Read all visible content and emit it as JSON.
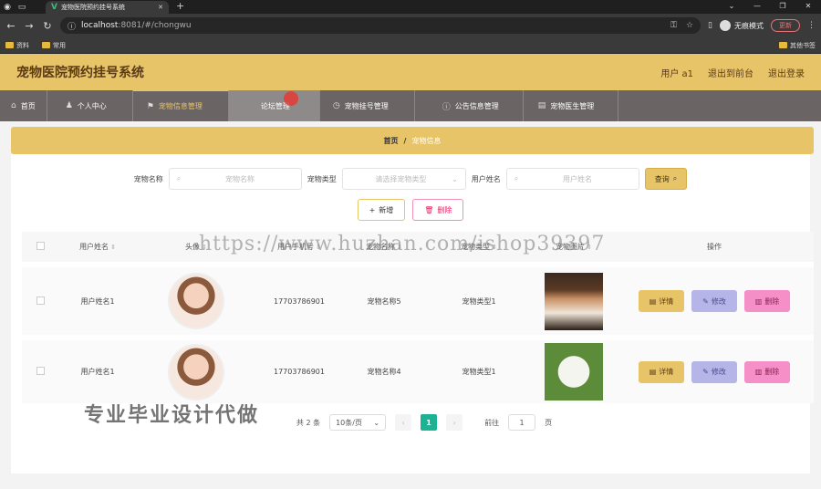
{
  "browser": {
    "tab_title": "宠物医院预约挂号系统",
    "url_host": "localhost",
    "url_port_path": ":8081/#/chongwu",
    "profile_label": "无痕模式",
    "update_label": "更新",
    "bookmarks": [
      "资料",
      "常用"
    ],
    "bookmark_right": "其他书签"
  },
  "header": {
    "title": "宠物医院预约挂号系统",
    "user": "用户 a1",
    "back_front": "退出到前台",
    "logout": "退出登录"
  },
  "nav": [
    {
      "label": "首页",
      "icon": "home-icon"
    },
    {
      "label": "个人中心",
      "icon": "user-icon"
    },
    {
      "label": "宠物信息管理",
      "icon": "flag-icon"
    },
    {
      "label": "论坛管理",
      "icon": "chat-icon"
    },
    {
      "label": "宠物挂号管理",
      "icon": "clock-icon"
    },
    {
      "label": "公告信息管理",
      "icon": "info-icon"
    },
    {
      "label": "宠物医生管理",
      "icon": "doc-icon"
    }
  ],
  "breadcrumb": {
    "home": "首页",
    "sep": "/",
    "current": "宠物信息"
  },
  "search": {
    "pet_name_label": "宠物名称",
    "pet_name_placeholder": "宠物名称",
    "pet_type_label": "宠物类型",
    "pet_type_placeholder": "请选择宠物类型",
    "user_name_label": "用户姓名",
    "user_name_placeholder": "用户姓名",
    "query_label": "查询"
  },
  "actions": {
    "add_label": "新增",
    "delete_label": "删除"
  },
  "table": {
    "headers": [
      "用户姓名",
      "头像",
      "用户手机号",
      "宠物名称",
      "宠物类型",
      "宠物图片",
      "操作"
    ],
    "rows": [
      {
        "user": "用户姓名1",
        "phone": "17703786901",
        "pet_name": "宠物名称5",
        "pet_type": "宠物类型1"
      },
      {
        "user": "用户姓名1",
        "phone": "17703786901",
        "pet_name": "宠物名称4",
        "pet_type": "宠物类型1"
      }
    ],
    "op_detail": "详情",
    "op_edit": "修改",
    "op_delete": "删除"
  },
  "pager": {
    "total": "共 2 条",
    "page_size": "10条/页",
    "current": "1",
    "goto_label": "前往",
    "goto_value": "1",
    "page_unit": "页"
  },
  "watermark": {
    "url": "https://www.huzhan.com/ishop39397",
    "cn": "专业毕业设计代做"
  },
  "colors": {
    "accent": "#e8c468",
    "nav_bg": "#6b6464",
    "pager_current": "#1bb394"
  }
}
